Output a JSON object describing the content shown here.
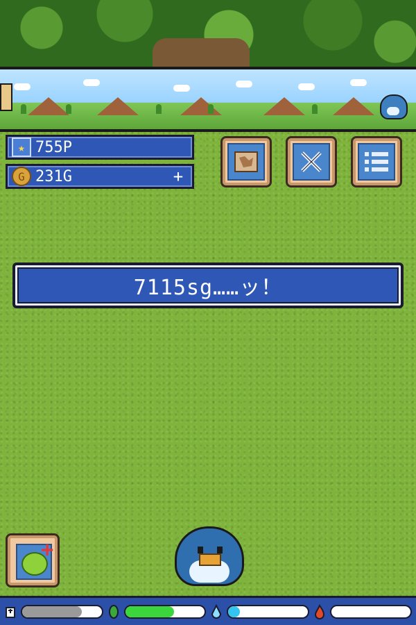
{
  "hud": {
    "points": "755P",
    "gold": "231G",
    "add_gold_label": "+"
  },
  "menu": {
    "items": [
      "map",
      "battle",
      "list"
    ]
  },
  "message": {
    "text": "7115sg……ッ！"
  },
  "status": {
    "meters": [
      {
        "name": "stamina",
        "icon": "tombstone-icon",
        "level": 0.75,
        "color": "#9a9a9a"
      },
      {
        "name": "food",
        "icon": "leaf-icon",
        "level": 0.62,
        "color": "#3bd63b"
      },
      {
        "name": "water",
        "icon": "water-drop-icon",
        "level": 0.15,
        "color": "#35c4f0"
      },
      {
        "name": "fire",
        "icon": "flame-icon",
        "level": 0.0,
        "color": "#e04a2a"
      }
    ]
  },
  "colors": {
    "panel_blue": "#2f57b5",
    "grass": "#7fb43c",
    "button_frame": "#f0c9a0"
  }
}
